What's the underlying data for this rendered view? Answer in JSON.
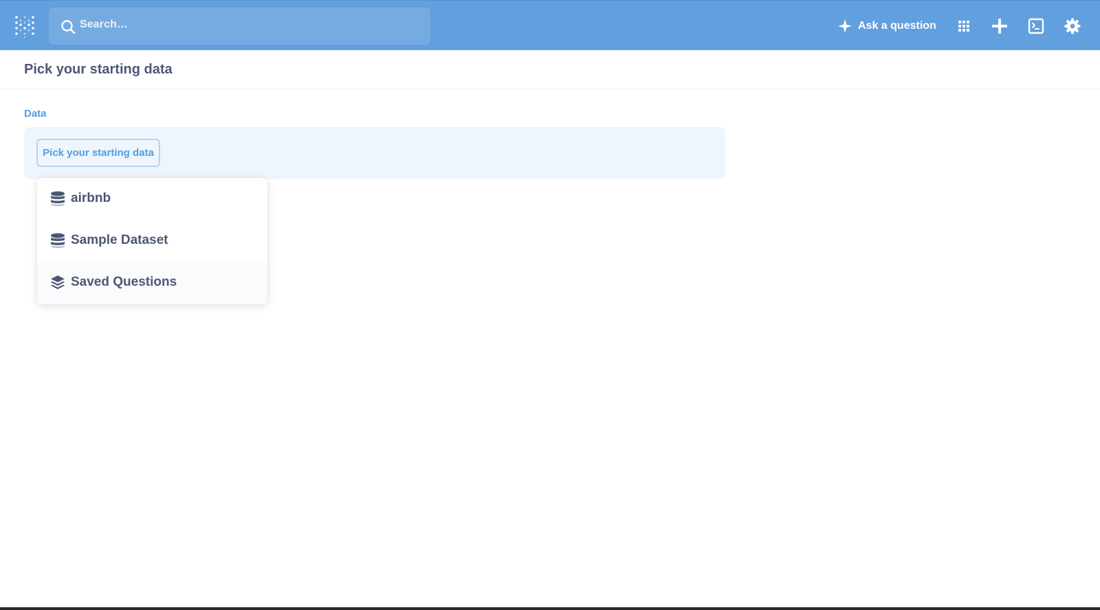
{
  "app": {
    "logo_icon": "metabase-logo-icon",
    "brand_color": "#629fde",
    "accent_color": "#509ee3"
  },
  "navbar": {
    "search_placeholder": "Search…",
    "ask_label": "Ask a question",
    "icons": [
      "sparkle-icon",
      "grid-icon",
      "plus-icon",
      "terminal-icon",
      "gear-icon"
    ]
  },
  "page": {
    "title": "Pick your starting data",
    "section_label": "Data",
    "pick_button": "Pick your starting data"
  },
  "dropdown": {
    "items": [
      {
        "label": "airbnb",
        "icon": "database-icon"
      },
      {
        "label": "Sample Dataset",
        "icon": "database-icon"
      },
      {
        "label": "Saved Questions",
        "icon": "layers-icon"
      }
    ]
  }
}
